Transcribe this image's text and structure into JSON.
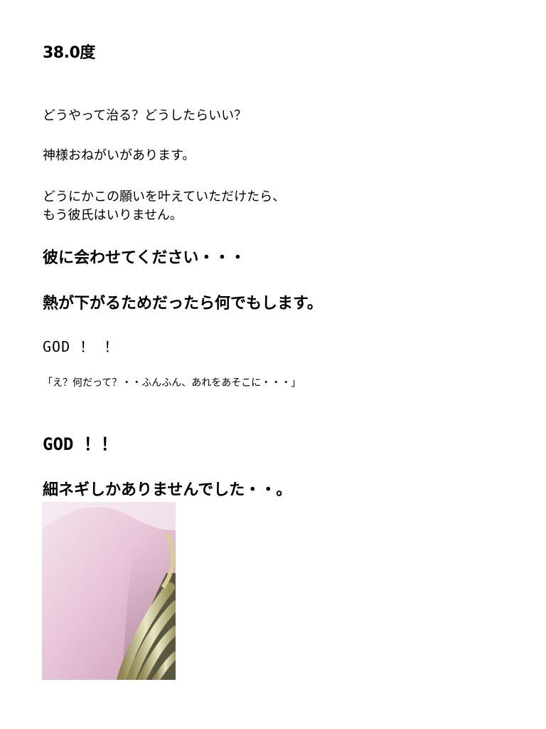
{
  "title": "38.0度",
  "paragraph1": "どうやって治る？どうしたらいい？",
  "paragraph2": "神様おねがいがあります。",
  "paragraph3_line1": "どうにかこの願いを叶えていただけたら、",
  "paragraph3_line2": "もう彼氏はいりません。",
  "plea1": "彼に会わせてください・・・",
  "plea2": "熱が下がるためだったら何でもします。",
  "god_small": "GOD ！ ！",
  "quote": "「え？何だって？・・ふんふん、あれをあそこに・・・」",
  "god_big": "GOD ！！",
  "closing": "細ネギしかありませんでした・・。",
  "photo_icon": "green-onion-photo"
}
